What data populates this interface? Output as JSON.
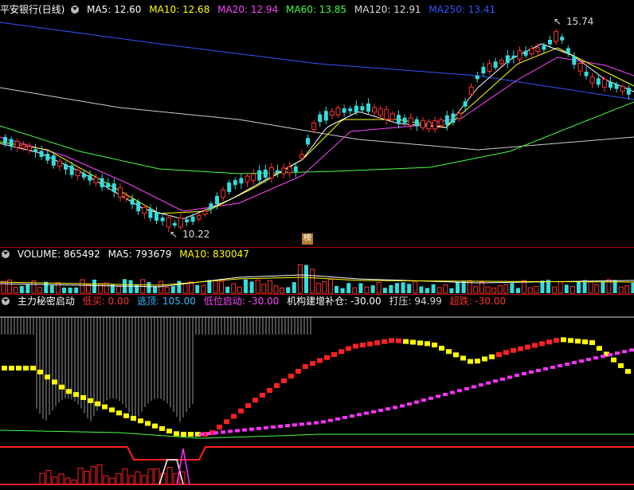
{
  "main_header": {
    "title": "平安银行(日线)",
    "ma": [
      {
        "label": "MA5: 12.60",
        "color": "#ffffff"
      },
      {
        "label": "MA10: 12.68",
        "color": "#ffff00"
      },
      {
        "label": "MA20: 12.94",
        "color": "#ff44ff"
      },
      {
        "label": "MA60: 13.85",
        "color": "#44ff44"
      },
      {
        "label": "MA120: 12.91",
        "color": "#dddddd"
      },
      {
        "label": "MA250: 13.41",
        "color": "#3355ff"
      }
    ]
  },
  "price_annotations": {
    "high": "15.74",
    "low": "10.22"
  },
  "badge": "榜",
  "volume_header": {
    "label": "VOLUME: 865492",
    "ma5": "MA5: 793679",
    "ma10": "MA10: 830047"
  },
  "indicator_header": {
    "name": "主力秘密启动",
    "items": [
      {
        "label": "低买: 0.00",
        "color": "#ff3030"
      },
      {
        "label": "逃顶: 105.00",
        "color": "#33bbff"
      },
      {
        "label": "低位启动: -30.00",
        "color": "#ff44ff"
      },
      {
        "label": "机构建增补仓: -30.00",
        "color": "#ffffff"
      },
      {
        "label": "打压: 94.99",
        "color": "#dddddd"
      },
      {
        "label": "超跌: -30.00",
        "color": "#ff3030"
      }
    ]
  },
  "colors": {
    "up": "#ff3333",
    "down": "#33dddd",
    "ma5": "#ffffff",
    "ma10": "#ffff00",
    "ma20": "#ff44ff",
    "ma60": "#44ff44",
    "ma120": "#cccccc",
    "ma250": "#3355ff"
  }
}
